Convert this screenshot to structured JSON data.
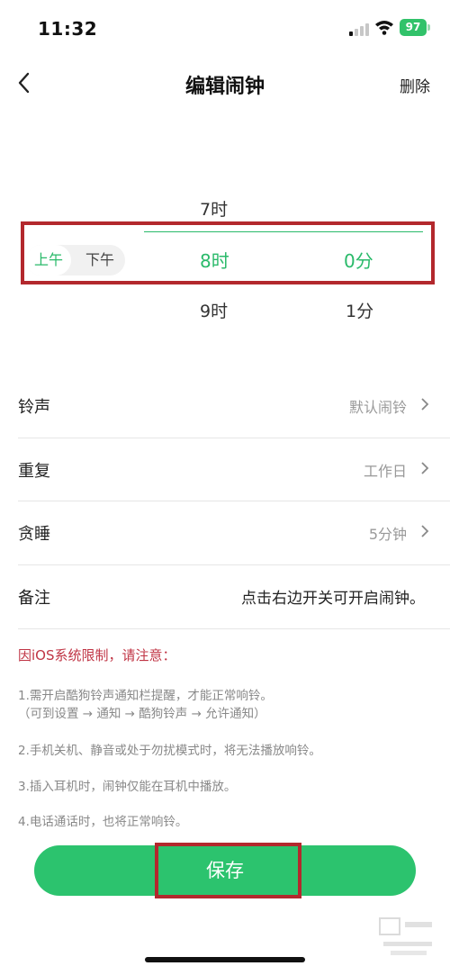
{
  "status_bar": {
    "time": "11:32",
    "battery": "97"
  },
  "header": {
    "title": "编辑闹钟",
    "delete_label": "删除"
  },
  "picker": {
    "period_options": [
      "上午",
      "下午"
    ],
    "selected_period": "上午",
    "hours": {
      "above": "7时",
      "selected": "8时",
      "below": "9时"
    },
    "minutes": {
      "selected": "0分",
      "below": "1分"
    }
  },
  "settings": [
    {
      "label": "铃声",
      "value": "默认闹铃"
    },
    {
      "label": "重复",
      "value": "工作日"
    },
    {
      "label": "贪睡",
      "value": "5分钟"
    }
  ],
  "note": {
    "label": "备注",
    "value": "点击右边开关可开启闹钟。"
  },
  "ios_notice": {
    "title": "因iOS系统限制，请注意：",
    "tips": [
      "1.需开启酷狗铃声通知栏提醒，才能正常响铃。",
      "（可到设置 → 通知 → 酷狗铃声 → 允许通知）",
      "2.手机关机、静音或处于勿扰模式时，将无法播放响铃。",
      "3.插入耳机时，闹钟仅能在耳机中播放。",
      "4.电话通话时，也将正常响铃。"
    ]
  },
  "save_label": "保存",
  "colors": {
    "accent": "#2aba6a",
    "save_button": "#2cc36e",
    "warning": "#c03545",
    "annotation": "#b3282d"
  }
}
